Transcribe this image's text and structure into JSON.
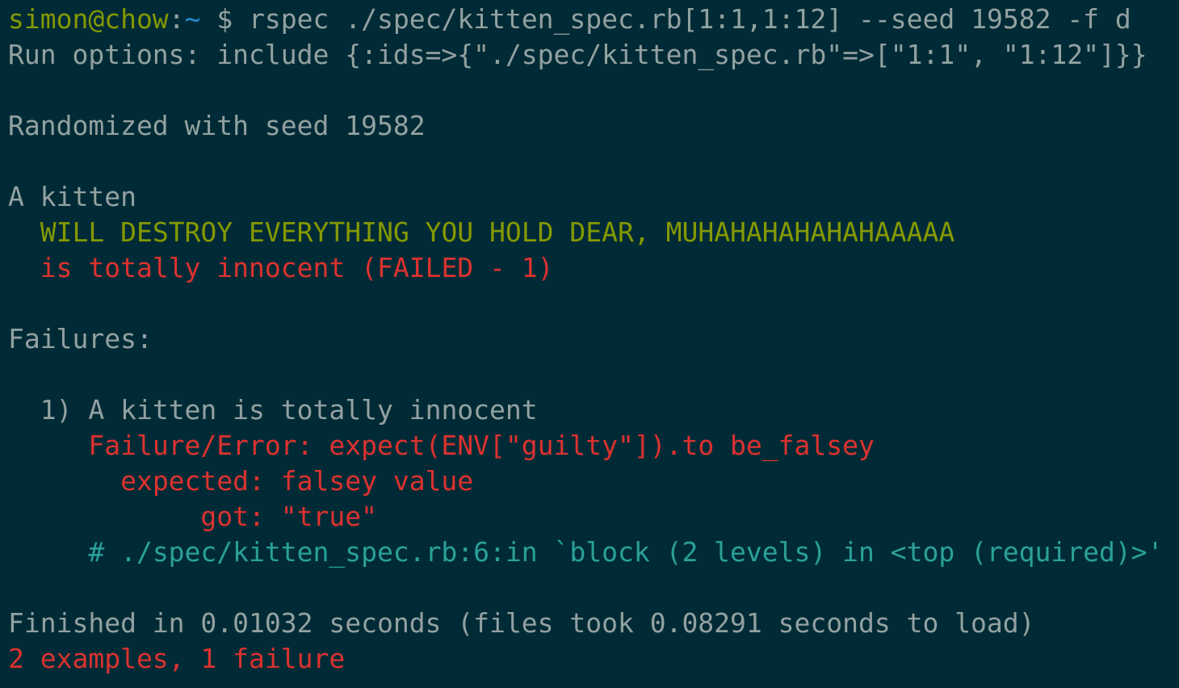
{
  "theme": {
    "background": "#002b36",
    "default_text": "#93a1a1",
    "green": "#859900",
    "blue": "#268bd2",
    "red": "#dc322f",
    "cyan": "#2aa198"
  },
  "terminal": {
    "prompt": {
      "user_host": "simon@chow",
      "separator": ":",
      "path": "~",
      "symbol": "$",
      "command": "rspec ./spec/kitten_spec.rb[1:1,1:12] --seed 19582 -f d"
    },
    "run_options": "Run options: include {:ids=>{\"./spec/kitten_spec.rb\"=>[\"1:1\", \"1:12\"]}}",
    "randomized": "Randomized with seed 19582",
    "group_name": "A kitten",
    "example_passed": "WILL DESTROY EVERYTHING YOU HOLD DEAR, MUHAHAHAHAHAHAAAAA",
    "example_failed": "is totally innocent (FAILED - 1)",
    "failures_header": "Failures:",
    "failure": {
      "title": "1) A kitten is totally innocent",
      "error_line": "Failure/Error: expect(ENV[\"guilty\"]).to be_falsey",
      "expected_line": "expected: falsey value",
      "got_line": "got: \"true\"",
      "backtrace": "# ./spec/kitten_spec.rb:6:in `block (2 levels) in <top (required)>'"
    },
    "finished": "Finished in 0.01032 seconds (files took 0.08291 seconds to load)",
    "summary": "2 examples, 1 failure"
  }
}
